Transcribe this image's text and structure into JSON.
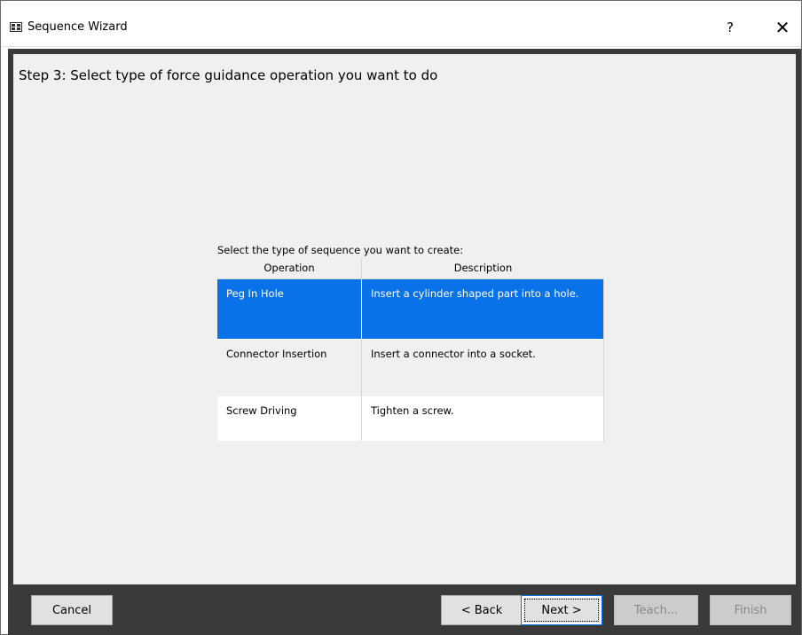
{
  "window": {
    "title": "Sequence Wizard",
    "help_glyph": "?",
    "close_glyph": "✕"
  },
  "step_title": "Step 3: Select type of force guidance operation you want to do",
  "grid": {
    "caption": "Select the type of sequence you want to create:",
    "columns": [
      "Operation",
      "Description"
    ],
    "rows": [
      {
        "operation": "Peg In Hole",
        "description": "Insert a cylinder shaped part into a hole.",
        "selected": true
      },
      {
        "operation": "Connector Insertion",
        "description": "Insert a connector into a socket.",
        "selected": false
      },
      {
        "operation": "Screw Driving",
        "description": "Tighten a screw.",
        "selected": false
      }
    ]
  },
  "buttons": {
    "cancel": "Cancel",
    "back": "< Back",
    "next": "Next >",
    "teach": "Teach...",
    "finish": "Finish"
  },
  "colors": {
    "selection": "#0a72e8",
    "panel_bg": "#f0f0f0",
    "frame": "#3a3a3a"
  },
  "icons": {
    "app": "sequence-wizard-icon",
    "help": "help-icon",
    "close": "close-icon"
  }
}
